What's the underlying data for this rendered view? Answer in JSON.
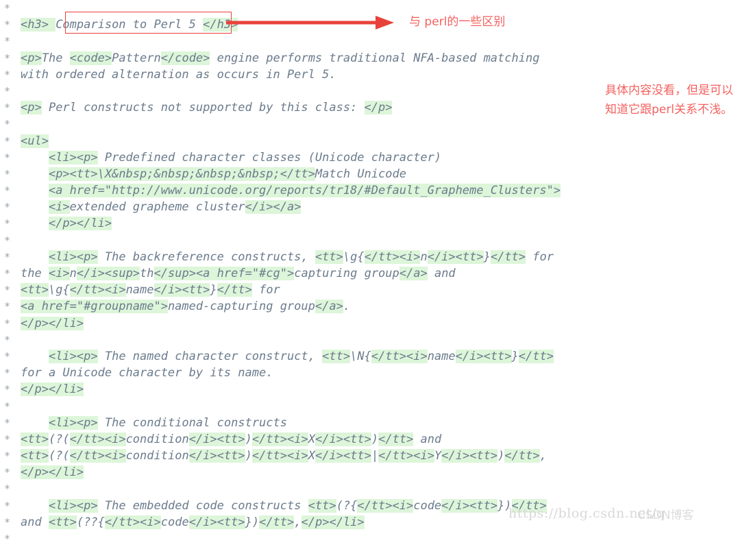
{
  "editor": {
    "gutter_marker": "*",
    "language": "javadoc-html",
    "highlight_color": "#ddf5d9",
    "text_color": "#6b7b8c",
    "annotation_color": "#f4615f",
    "box_color": "#e8413c"
  },
  "lines": [
    {
      "star": "*",
      "segments": []
    },
    {
      "star": "*",
      "segments": [
        {
          "t": "<h3> ",
          "hl": true
        },
        {
          "t": "Comparison to Perl 5 ",
          "hl": false
        },
        {
          "t": "</h3>",
          "hl": true
        }
      ]
    },
    {
      "star": "*",
      "segments": []
    },
    {
      "star": "*",
      "segments": [
        {
          "t": "<p>",
          "hl": true
        },
        {
          "t": "The ",
          "hl": false
        },
        {
          "t": "<code>",
          "hl": true
        },
        {
          "t": "Pattern",
          "hl": false
        },
        {
          "t": "</code>",
          "hl": true
        },
        {
          "t": " engine performs traditional NFA-based matching",
          "hl": false
        }
      ]
    },
    {
      "star": "*",
      "segments": [
        {
          "t": "with ordered alternation as occurs in Perl 5.",
          "hl": false
        }
      ]
    },
    {
      "star": "*",
      "segments": []
    },
    {
      "star": "*",
      "segments": [
        {
          "t": "<p>",
          "hl": true
        },
        {
          "t": " Perl constructs not supported by this class: ",
          "hl": false
        },
        {
          "t": "</p>",
          "hl": true
        }
      ]
    },
    {
      "star": "*",
      "segments": []
    },
    {
      "star": "*",
      "segments": [
        {
          "t": "<ul>",
          "hl": true
        }
      ]
    },
    {
      "star": "*",
      "segments": [
        {
          "t": "    ",
          "hl": false
        },
        {
          "t": "<li><p>",
          "hl": true
        },
        {
          "t": " Predefined character classes (Unicode character)",
          "hl": false
        }
      ]
    },
    {
      "star": "*",
      "segments": [
        {
          "t": "    ",
          "hl": false
        },
        {
          "t": "<p><tt>",
          "hl": true
        },
        {
          "t": "\\X&nbsp;&nbsp;&nbsp;&nbsp;",
          "hl": true
        },
        {
          "t": "</tt>",
          "hl": true
        },
        {
          "t": "Match Unicode",
          "hl": false
        }
      ]
    },
    {
      "star": "*",
      "segments": [
        {
          "t": "    ",
          "hl": false
        },
        {
          "t": "<a href=\"http://www.unicode.org/reports/tr18/#Default_Grapheme_Clusters\">",
          "hl": true
        }
      ]
    },
    {
      "star": "*",
      "segments": [
        {
          "t": "    ",
          "hl": false
        },
        {
          "t": "<i>",
          "hl": true
        },
        {
          "t": "extended grapheme cluster",
          "hl": false
        },
        {
          "t": "</i></a>",
          "hl": true
        }
      ]
    },
    {
      "star": "*",
      "segments": [
        {
          "t": "    ",
          "hl": false
        },
        {
          "t": "</p></li>",
          "hl": true
        }
      ]
    },
    {
      "star": "*",
      "segments": []
    },
    {
      "star": "*",
      "segments": [
        {
          "t": "    ",
          "hl": false
        },
        {
          "t": "<li><p>",
          "hl": true
        },
        {
          "t": " The backreference constructs, ",
          "hl": false
        },
        {
          "t": "<tt>",
          "hl": true
        },
        {
          "t": "\\g{",
          "hl": false
        },
        {
          "t": "</tt><i>",
          "hl": true
        },
        {
          "t": "n",
          "hl": false
        },
        {
          "t": "</i><tt>",
          "hl": true
        },
        {
          "t": "}",
          "hl": false
        },
        {
          "t": "</tt>",
          "hl": true
        },
        {
          "t": " for",
          "hl": false
        }
      ]
    },
    {
      "star": "*",
      "segments": [
        {
          "t": "the ",
          "hl": false
        },
        {
          "t": "<i>",
          "hl": true
        },
        {
          "t": "n",
          "hl": false
        },
        {
          "t": "</i><sup>",
          "hl": true
        },
        {
          "t": "th",
          "hl": false
        },
        {
          "t": "</sup><a href=\"#cg\">",
          "hl": true
        },
        {
          "t": "capturing group",
          "hl": false
        },
        {
          "t": "</a>",
          "hl": true
        },
        {
          "t": " and",
          "hl": false
        }
      ]
    },
    {
      "star": "*",
      "segments": [
        {
          "t": "<tt>",
          "hl": true
        },
        {
          "t": "\\g{",
          "hl": false
        },
        {
          "t": "</tt><i>",
          "hl": true
        },
        {
          "t": "name",
          "hl": false
        },
        {
          "t": "</i><tt>",
          "hl": true
        },
        {
          "t": "}",
          "hl": false
        },
        {
          "t": "</tt>",
          "hl": true
        },
        {
          "t": " for",
          "hl": false
        }
      ]
    },
    {
      "star": "*",
      "segments": [
        {
          "t": "<a href=\"#groupname\">",
          "hl": true
        },
        {
          "t": "named-capturing group",
          "hl": false
        },
        {
          "t": "</a>",
          "hl": true
        },
        {
          "t": ".",
          "hl": false
        }
      ]
    },
    {
      "star": "*",
      "segments": [
        {
          "t": "</p></li>",
          "hl": true
        }
      ]
    },
    {
      "star": "*",
      "segments": []
    },
    {
      "star": "*",
      "segments": [
        {
          "t": "    ",
          "hl": false
        },
        {
          "t": "<li><p>",
          "hl": true
        },
        {
          "t": " The named character construct, ",
          "hl": false
        },
        {
          "t": "<tt>",
          "hl": true
        },
        {
          "t": "\\N{",
          "hl": false
        },
        {
          "t": "</tt><i>",
          "hl": true
        },
        {
          "t": "name",
          "hl": false
        },
        {
          "t": "</i><tt>",
          "hl": true
        },
        {
          "t": "}",
          "hl": false
        },
        {
          "t": "</tt>",
          "hl": true
        }
      ]
    },
    {
      "star": "*",
      "segments": [
        {
          "t": "for a Unicode character by its name.",
          "hl": false
        }
      ]
    },
    {
      "star": "*",
      "segments": [
        {
          "t": "</p></li>",
          "hl": true
        }
      ]
    },
    {
      "star": "*",
      "segments": []
    },
    {
      "star": "*",
      "segments": [
        {
          "t": "    ",
          "hl": false
        },
        {
          "t": "<li><p>",
          "hl": true
        },
        {
          "t": " The conditional constructs",
          "hl": false
        }
      ]
    },
    {
      "star": "*",
      "segments": [
        {
          "t": "<tt>",
          "hl": true
        },
        {
          "t": "(?(",
          "hl": false
        },
        {
          "t": "</tt><i>",
          "hl": true
        },
        {
          "t": "condition",
          "hl": false
        },
        {
          "t": "</i><tt>",
          "hl": true
        },
        {
          "t": ")",
          "hl": false
        },
        {
          "t": "</tt><i>",
          "hl": true
        },
        {
          "t": "X",
          "hl": false
        },
        {
          "t": "</i><tt>",
          "hl": true
        },
        {
          "t": ")",
          "hl": false
        },
        {
          "t": "</tt>",
          "hl": true
        },
        {
          "t": " and",
          "hl": false
        }
      ]
    },
    {
      "star": "*",
      "segments": [
        {
          "t": "<tt>",
          "hl": true
        },
        {
          "t": "(?(",
          "hl": false
        },
        {
          "t": "</tt><i>",
          "hl": true
        },
        {
          "t": "condition",
          "hl": false
        },
        {
          "t": "</i><tt>",
          "hl": true
        },
        {
          "t": ")",
          "hl": false
        },
        {
          "t": "</tt><i>",
          "hl": true
        },
        {
          "t": "X",
          "hl": false
        },
        {
          "t": "</i><tt>",
          "hl": true
        },
        {
          "t": "|",
          "hl": false
        },
        {
          "t": "</tt><i>",
          "hl": true
        },
        {
          "t": "Y",
          "hl": false
        },
        {
          "t": "</i><tt>",
          "hl": true
        },
        {
          "t": ")",
          "hl": false
        },
        {
          "t": "</tt>",
          "hl": true
        },
        {
          "t": ",",
          "hl": false
        }
      ]
    },
    {
      "star": "*",
      "segments": [
        {
          "t": "</p></li>",
          "hl": true
        }
      ]
    },
    {
      "star": "*",
      "segments": []
    },
    {
      "star": "*",
      "segments": [
        {
          "t": "    ",
          "hl": false
        },
        {
          "t": "<li><p>",
          "hl": true
        },
        {
          "t": " The embedded code constructs ",
          "hl": false
        },
        {
          "t": "<tt>",
          "hl": true
        },
        {
          "t": "(?{",
          "hl": false
        },
        {
          "t": "</tt><i>",
          "hl": true
        },
        {
          "t": "code",
          "hl": false
        },
        {
          "t": "</i><tt>",
          "hl": true
        },
        {
          "t": "})",
          "hl": false
        },
        {
          "t": "</tt>",
          "hl": true
        }
      ]
    },
    {
      "star": "*",
      "segments": [
        {
          "t": "and ",
          "hl": false
        },
        {
          "t": "<tt>",
          "hl": true
        },
        {
          "t": "(??{",
          "hl": false
        },
        {
          "t": "</tt><i>",
          "hl": true
        },
        {
          "t": "code",
          "hl": false
        },
        {
          "t": "</i><tt>",
          "hl": true
        },
        {
          "t": "})",
          "hl": false
        },
        {
          "t": "</tt>",
          "hl": true
        },
        {
          "t": ",",
          "hl": false
        },
        {
          "t": "</p></li>",
          "hl": true
        }
      ]
    },
    {
      "star": "*",
      "segments": []
    }
  ],
  "annotations": {
    "arrow_note": "与 perl的一些区别",
    "side_note": "具体内容没看，但是可以知道它跟perl关系不浅。"
  },
  "watermark": {
    "url": "https://blog.csdn.net/q",
    "logo": "CSDN博客"
  }
}
